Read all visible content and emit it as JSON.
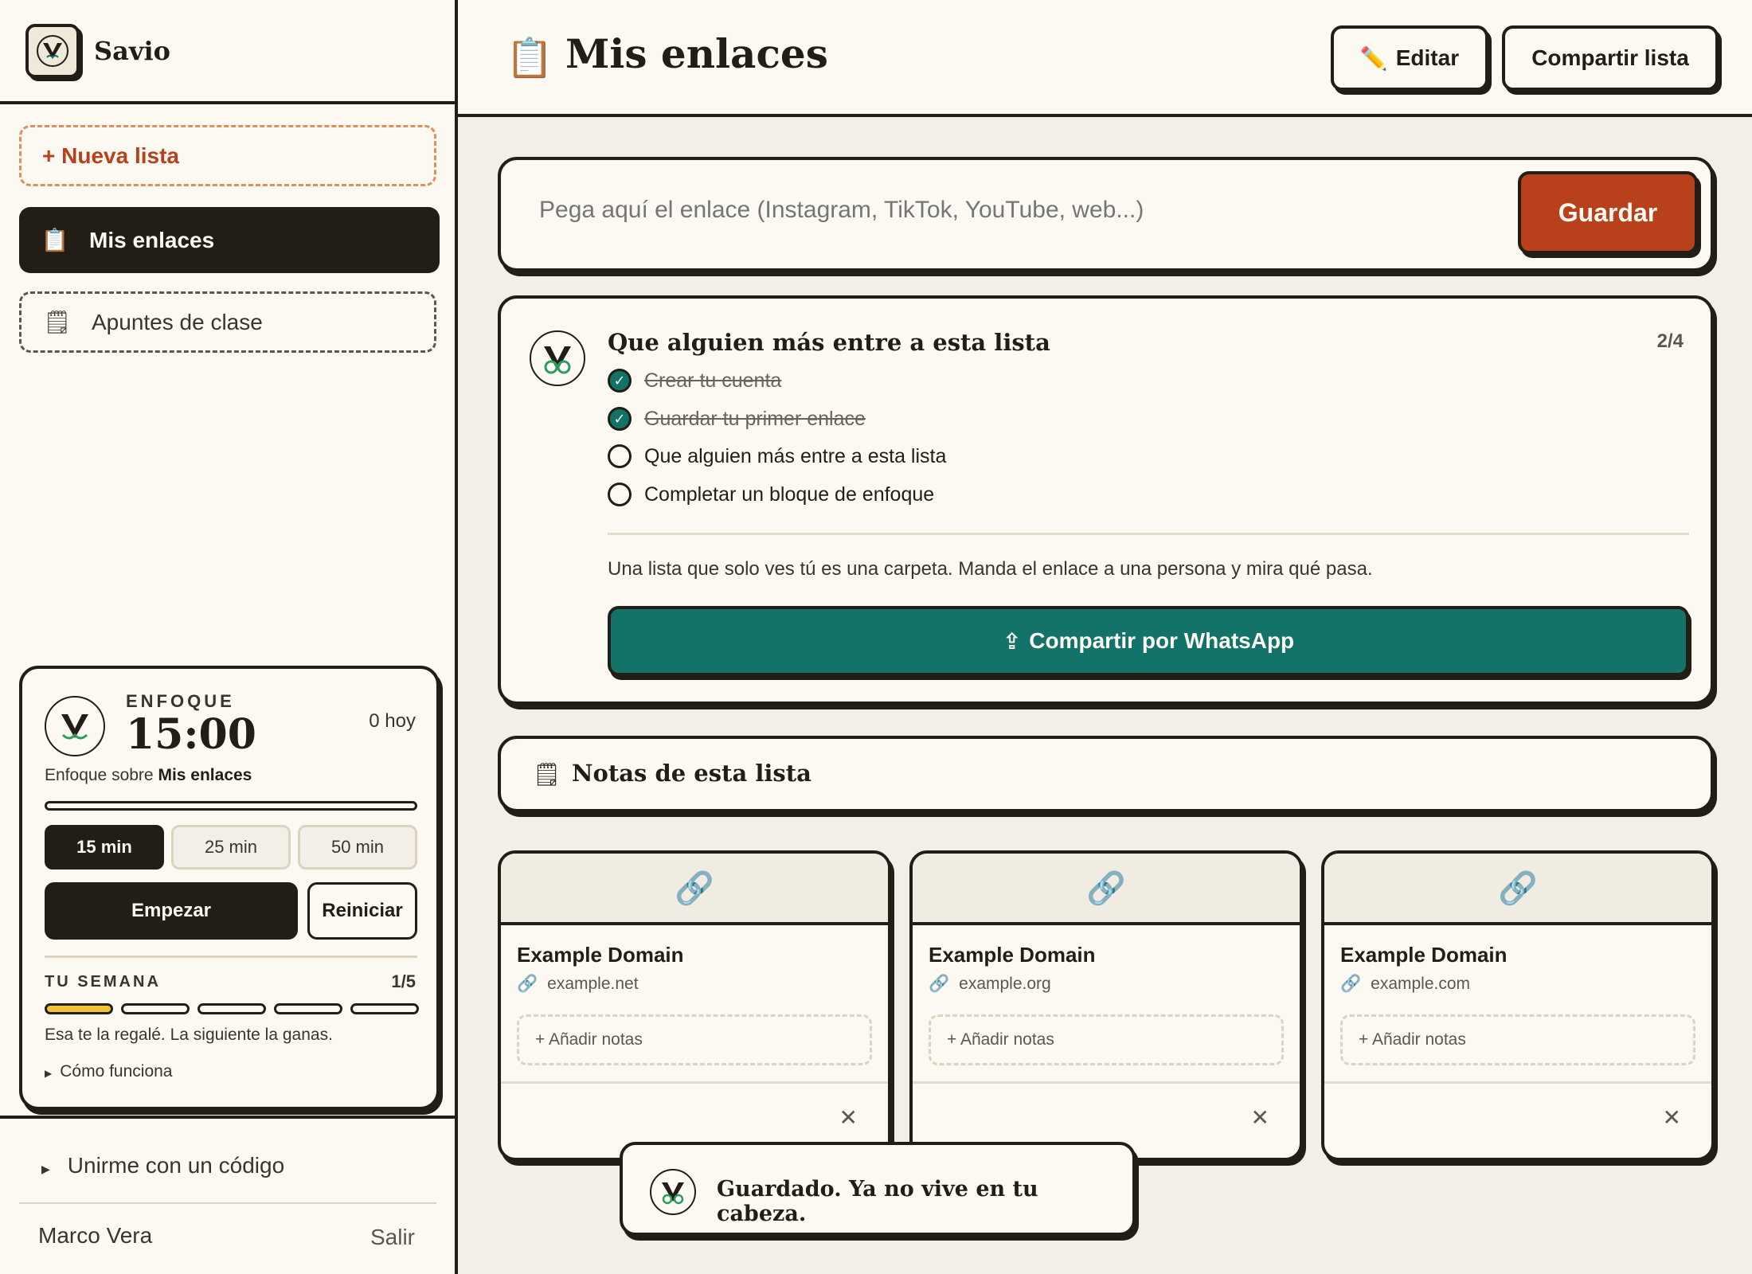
{
  "colors": {
    "ink": "#231d18",
    "paper": "#fcf9f2",
    "background": "#f3efe6",
    "accent_orange": "#b8401a",
    "accent_teal": "#137368",
    "week_fill": "#f2c233"
  },
  "sidebar": {
    "brand": "Savio",
    "new_list": "+ Nueva lista",
    "lists": [
      {
        "icon": "clipboard-icon",
        "label": "Mis enlaces",
        "active": true
      },
      {
        "icon": "notepad-icon",
        "label": "Apuntes de clase",
        "active": false
      }
    ],
    "focus": {
      "label": "ENFOQUE",
      "time": "15:00",
      "today": "0 hoy",
      "subtitle_prefix": "Enfoque sobre",
      "subtitle_target": "Mis enlaces",
      "progress": 0,
      "durations": [
        "15 min",
        "25 min",
        "50 min"
      ],
      "selected_duration": "15 min",
      "start": "Empezar",
      "reset": "Reiniciar",
      "week_label": "TU SEMANA",
      "week_count": "1/5",
      "week_filled": 1,
      "week_total": 5,
      "week_message": "Esa te la regalé. La siguiente la ganas.",
      "how_it_works": "Cómo funciona"
    },
    "join_code": "Unirme con un código",
    "user_name": "Marco Vera",
    "logout": "Salir"
  },
  "header": {
    "icon": "clipboard-icon",
    "title": "Mis enlaces",
    "edit": "Editar",
    "share": "Compartir lista"
  },
  "save": {
    "placeholder": "Pega aquí el enlace (Instagram, TikTok, YouTube, web...)",
    "button": "Guardar"
  },
  "onboarding": {
    "title": "Que alguien más entre a esta lista",
    "progress": "2/4",
    "tasks": [
      {
        "label": "Crear tu cuenta",
        "done": true
      },
      {
        "label": "Guardar tu primer enlace",
        "done": true
      },
      {
        "label": "Que alguien más entre a esta lista",
        "done": false
      },
      {
        "label": "Completar un bloque de enfoque",
        "done": false
      }
    ],
    "message": "Una lista que solo ves tú es una carpeta. Manda el enlace a una persona y mira qué pasa.",
    "whatsapp": "Compartir por WhatsApp"
  },
  "notes": {
    "icon": "notepad-icon",
    "title": "Notas de esta lista"
  },
  "cards": [
    {
      "title": "Example Domain",
      "domain": "example.net",
      "add_notes": "+ Añadir notas"
    },
    {
      "title": "Example Domain",
      "domain": "example.org",
      "add_notes": "+ Añadir notas"
    },
    {
      "title": "Example Domain",
      "domain": "example.com",
      "add_notes": "+ Añadir notas"
    }
  ],
  "toast": {
    "message": "Guardado. Ya no vive en tu cabeza."
  }
}
